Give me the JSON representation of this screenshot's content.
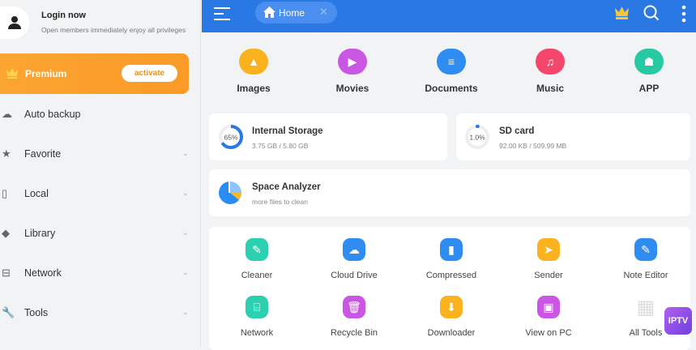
{
  "sidebar": {
    "login_title": "Login now",
    "login_subtitle": "Open members immediately enjoy all privileges",
    "premium_label": "Premium",
    "activate_label": "activate",
    "items": [
      {
        "label": "Auto backup",
        "icon": "cloud-icon",
        "expandable": false
      },
      {
        "label": "Favorite",
        "icon": "star-icon",
        "expandable": true
      },
      {
        "label": "Local",
        "icon": "phone-icon",
        "expandable": true
      },
      {
        "label": "Library",
        "icon": "layers-icon",
        "expandable": true
      },
      {
        "label": "Network",
        "icon": "network-icon",
        "expandable": true
      },
      {
        "label": "Tools",
        "icon": "wrench-icon",
        "expandable": true
      }
    ]
  },
  "header": {
    "tab_label": "Home",
    "accent": "#2a78e4"
  },
  "categories": [
    {
      "label": "Images",
      "color": "#fbb21f"
    },
    {
      "label": "Movies",
      "color": "#c957e3"
    },
    {
      "label": "Documents",
      "color": "#2f8cf0"
    },
    {
      "label": "Music",
      "color": "#f5466c"
    },
    {
      "label": "APP",
      "color": "#27c9a3"
    }
  ],
  "storage": {
    "internal": {
      "title": "Internal Storage",
      "percent_label": "65%",
      "percent": 65,
      "usage": "3.75 GB / 5.80 GB"
    },
    "sd": {
      "title": "SD card",
      "percent_label": "1.0%",
      "percent": 1,
      "usage": "92.00 KB / 509.99 MB"
    }
  },
  "analyzer": {
    "title": "Space Analyzer",
    "subtitle": "more files to clean"
  },
  "tools": [
    {
      "label": "Cleaner",
      "color": "#2ccfb0",
      "icon": "broom-icon"
    },
    {
      "label": "Cloud Drive",
      "color": "#2f8cf0",
      "icon": "cloud-icon"
    },
    {
      "label": "Compressed",
      "color": "#2f8cf0",
      "icon": "zip-icon"
    },
    {
      "label": "Sender",
      "color": "#fbb21f",
      "icon": "send-icon"
    },
    {
      "label": "Note Editor",
      "color": "#2f8cf0",
      "icon": "note-icon"
    },
    {
      "label": "Network",
      "color": "#2ccfb0",
      "icon": "router-icon"
    },
    {
      "label": "Recycle Bin",
      "color": "#c957e3",
      "icon": "trash-icon"
    },
    {
      "label": "Downloader",
      "color": "#fbb21f",
      "icon": "download-icon"
    },
    {
      "label": "View on PC",
      "color": "#c957e3",
      "icon": "monitor-icon"
    },
    {
      "label": "All Tools",
      "color": "#dddddd",
      "icon": "grid-icon"
    }
  ],
  "overlay_badge": "IPTV"
}
